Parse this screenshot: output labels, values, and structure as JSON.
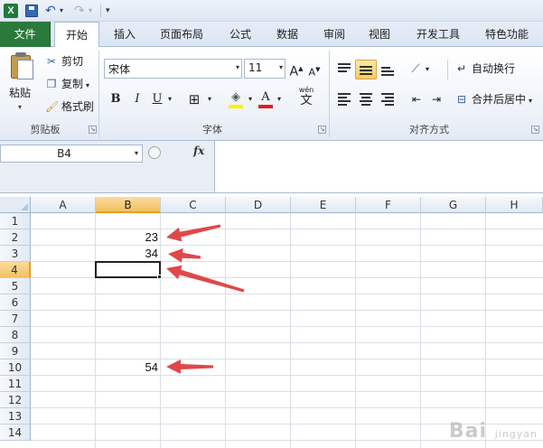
{
  "qat": {
    "app_icon": "excel-icon",
    "app_icon_letter": "X",
    "save_icon": "save-icon",
    "undo_icon": "undo-icon",
    "redo_icon": "redo-icon"
  },
  "tabs": [
    {
      "label": "文件"
    },
    {
      "label": "开始"
    },
    {
      "label": "插入"
    },
    {
      "label": "页面布局"
    },
    {
      "label": "公式"
    },
    {
      "label": "数据"
    },
    {
      "label": "审阅"
    },
    {
      "label": "视图"
    },
    {
      "label": "开发工具"
    },
    {
      "label": "特色功能"
    }
  ],
  "ribbon": {
    "clipboard": {
      "group_label": "剪贴板",
      "paste_label": "粘贴",
      "cut_label": "剪切",
      "copy_label": "复制",
      "format_painter_label": "格式刷"
    },
    "font": {
      "group_label": "字体",
      "font_name": "宋体",
      "font_size": "11",
      "grow_label": "A",
      "shrink_label": "A",
      "bold_label": "B",
      "italic_label": "I",
      "underline_label": "U",
      "font_color_label": "A",
      "phonetic_label": "wén",
      "phonetic_char": "文"
    },
    "alignment": {
      "group_label": "对齐方式",
      "wrap_label": "自动换行",
      "merge_label": "合并后居中"
    }
  },
  "formula_bar": {
    "name_box": "B4",
    "fx_label": "fx",
    "formula": ""
  },
  "sheet": {
    "columns": [
      "A",
      "B",
      "C",
      "D",
      "E",
      "F",
      "G",
      "H"
    ],
    "rows": [
      "1",
      "2",
      "3",
      "4",
      "5",
      "6",
      "7",
      "8",
      "9",
      "10",
      "11",
      "12",
      "13",
      "14"
    ],
    "active_cell": "B4",
    "active_column": "B",
    "active_row": "4",
    "cells": [
      {
        "ref": "B2",
        "value": "23"
      },
      {
        "ref": "B3",
        "value": "34"
      },
      {
        "ref": "B10",
        "value": "54"
      }
    ],
    "annotation_arrow_color": "#e04848"
  },
  "watermark": {
    "text": "Bai",
    "sub": "jingyan"
  }
}
